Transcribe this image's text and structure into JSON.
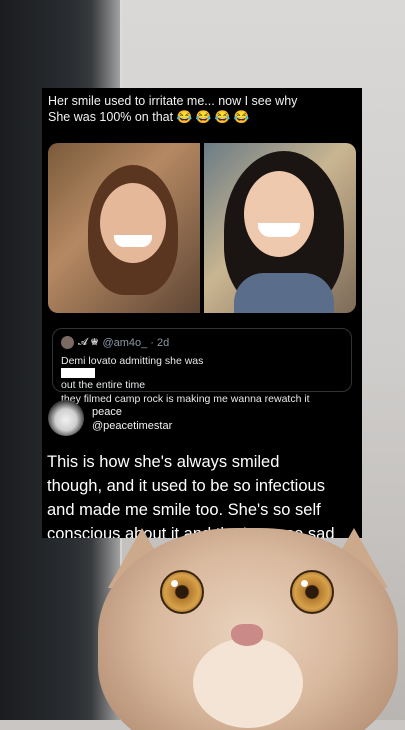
{
  "tweet": {
    "text_lines": [
      "Her smile used to irritate me... now I see why",
      "She was 100% on that 😂 😂 😂 😂"
    ]
  },
  "quote": {
    "name": "𝓐 ♛",
    "handle_time": "@am4o_ · 2d",
    "line1_before": "Demi lovato admitting she was",
    "line1_after": " out the entire time",
    "line2": "they filmed camp rock is making me wanna rewatch it"
  },
  "reply": {
    "name": "peace",
    "handle": "@peacetimestar",
    "lines": [
      "This is how she's always smiled",
      "though, and it used to be so infectious",
      "and made me smile too. She's so self",
      "conscious about it and that's so, so sad"
    ]
  },
  "icons": {
    "avatar": "quote-avatar",
    "reply_avatar": "reply-avatar",
    "emoji": "tears-of-joy"
  },
  "colors": {
    "card_bg": "#000000",
    "secondary_text": "#8b98a5",
    "border": "#2f3336"
  }
}
